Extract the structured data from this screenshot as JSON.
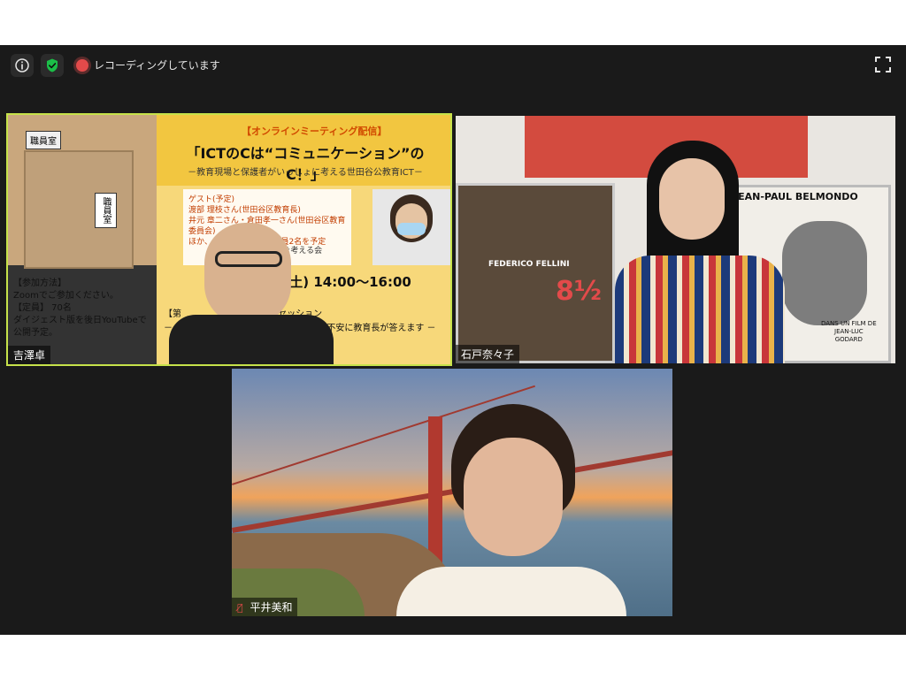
{
  "toolbar": {
    "recording_label": "レコーディングしています",
    "info_icon": "info-icon",
    "security_icon": "shield-check-icon",
    "fullscreen_icon": "fullscreen-icon"
  },
  "tiles": {
    "t1": {
      "name": "吉澤卓",
      "room_sign_top": "職員室",
      "room_sign_door": "職員室",
      "slide": {
        "tag": "【オンラインミーティング配信】",
        "title": "「ICTのCは“コミュニケーション”のC！」",
        "subtitle": "－教育現場と保護者がいっしょに考える世田谷公教育ICT－",
        "guest_lines": [
          "ゲスト(予定)",
          "渡部 理枝さん(世田谷区教育長)",
          "井元 章二さん・倉田孝一さん(世田谷区教育委員会)",
          "ほか、…名, 区内中学校教員2名を予定"
        ],
        "org": "谷公教育ICTを考える会",
        "date": "5日(土) 14:00～16:00",
        "session": "【第",
        "session_cont": "くセッション",
        "qa": "－ ア",
        "qa_cont": "あがった疑問や不安に教育長が答えます －"
      },
      "info_lines": [
        "【参加方法】",
        "Zoomでご参加ください。",
        "【定員】 70名",
        "ダイジェスト版を後日YouTubeで公開予定。"
      ]
    },
    "t2": {
      "name": "石戸奈々子",
      "poster_left": "FEDERICO FELLINI",
      "poster_left_big": "8½",
      "poster_right_top": "JEAN-PAUL BELMONDO",
      "poster_right_credit": [
        "DANS UN FILM DE",
        "JEAN-LUC",
        "GODARD"
      ]
    },
    "t3": {
      "name": "平井美和",
      "mic_muted_icon": "mic-muted-icon"
    }
  },
  "colors": {
    "active_speaker": "#c6e24a",
    "recording": "#e34a4a"
  }
}
